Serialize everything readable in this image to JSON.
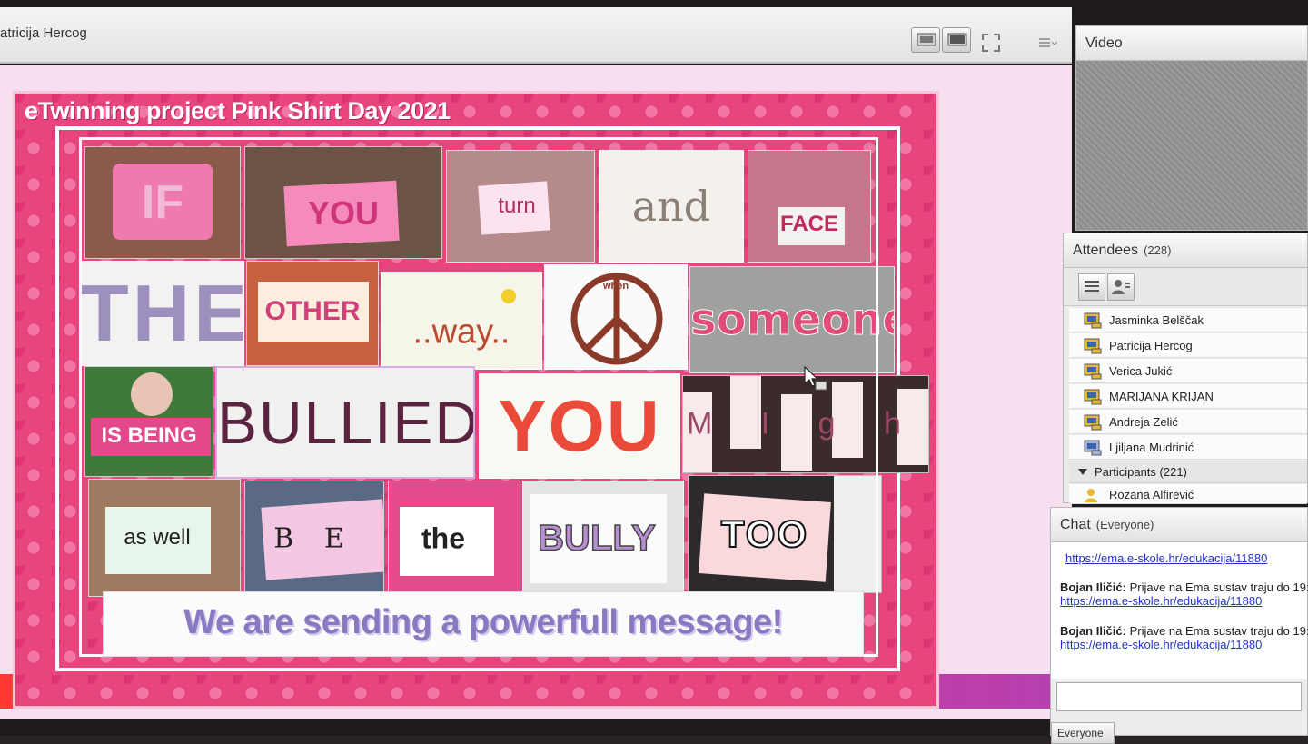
{
  "share_pod": {
    "title": "atricija Hercog"
  },
  "slide": {
    "title": "eTwinning project Pink Shirt Day 2021",
    "message": "We are sending a powerfull message!",
    "words": [
      {
        "text": "IF",
        "color": "#f3c4dc"
      },
      {
        "text": "YOU",
        "color": "#d0357c"
      },
      {
        "text": "turn",
        "color": "#b03060"
      },
      {
        "text": "and",
        "color": "#8a7f75"
      },
      {
        "text": "FACE",
        "color": "#c5285a"
      },
      {
        "text": "THE",
        "color": "#8f7fb5"
      },
      {
        "text": "OTHER",
        "color": "#d23f7a"
      },
      {
        "text": "..way..",
        "color": "#b94a2e"
      },
      {
        "text": "when",
        "color": "#8b3a2a"
      },
      {
        "text": "someone",
        "color": "#e04b7a"
      },
      {
        "text": "IS BEING",
        "color": "#ffffff"
      },
      {
        "text": "BULLIED",
        "color": "#5a2340"
      },
      {
        "text": "YOU",
        "color": "#e94a3a"
      },
      {
        "text": "M I g h t",
        "color": "#9c4a6a"
      },
      {
        "text": "as well",
        "color": "#222222"
      },
      {
        "text": "B E",
        "color": "#222222"
      },
      {
        "text": "the",
        "color": "#222222"
      },
      {
        "text": "BULLY",
        "color": "#b78fd2"
      },
      {
        "text": "TOO",
        "color": "#111111"
      }
    ]
  },
  "video_pod": {
    "title": "Video"
  },
  "attendees_pod": {
    "title": "Attendees",
    "count": "(228)",
    "hosts": [
      "Jasminka Belščak",
      "Patricija Hercog",
      "Verica Jukić",
      "MARIJANA KRIJAN",
      "Andreja Zelić",
      "Ljiljana Mudrinić"
    ],
    "participants_label": "Participants (221)",
    "participants": [
      "Rozana Alfirević"
    ]
  },
  "chat_pod": {
    "title": "Chat",
    "scope": "(Everyone)",
    "messages": [
      {
        "sender": "",
        "text": "",
        "link": "https://ema.e-skole.hr/edukacija/11880"
      },
      {
        "sender": "Bojan Iličić:",
        "text": " Prijave na Ema sustav traju do 19:",
        "link": "https://ema.e-skole.hr/edukacija/11880"
      },
      {
        "sender": "Bojan Iličić:",
        "text": " Prijave na Ema sustav traju do 19:",
        "link": "https://ema.e-skole.hr/edukacija/11880"
      }
    ],
    "target": "Everyone"
  }
}
